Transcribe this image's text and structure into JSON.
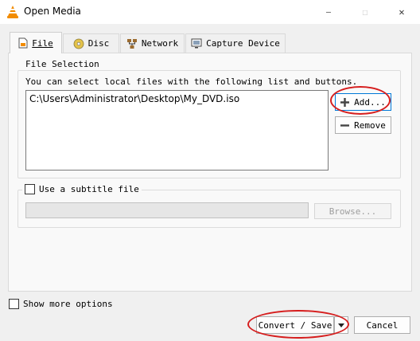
{
  "window": {
    "title": "Open Media",
    "minimize_symbol": "—",
    "maximize_symbol": "☐",
    "close_symbol": "✕"
  },
  "tabs": [
    {
      "label": "File",
      "icon": "file-icon"
    },
    {
      "label": "Disc",
      "icon": "disc-icon"
    },
    {
      "label": "Network",
      "icon": "network-icon"
    },
    {
      "label": "Capture Device",
      "icon": "capture-device-icon"
    }
  ],
  "file_selection": {
    "legend": "File Selection",
    "description": "You can select local files with the following list and buttons.",
    "files": [
      "C:\\Users\\Administrator\\Desktop\\My_DVD.iso"
    ],
    "add_label": "Add...",
    "remove_label": "Remove"
  },
  "subtitle": {
    "checkbox_label": "Use a subtitle file",
    "checked": false,
    "path_value": "",
    "browse_label": "Browse..."
  },
  "options": {
    "show_more_label": "Show more options",
    "checked": false
  },
  "footer": {
    "convert_label": "Convert / Save",
    "cancel_label": "Cancel"
  },
  "colors": {
    "highlight_oval": "#d61d1d",
    "vlc_orange": "#f28c00",
    "focus_border": "#0078d7"
  }
}
